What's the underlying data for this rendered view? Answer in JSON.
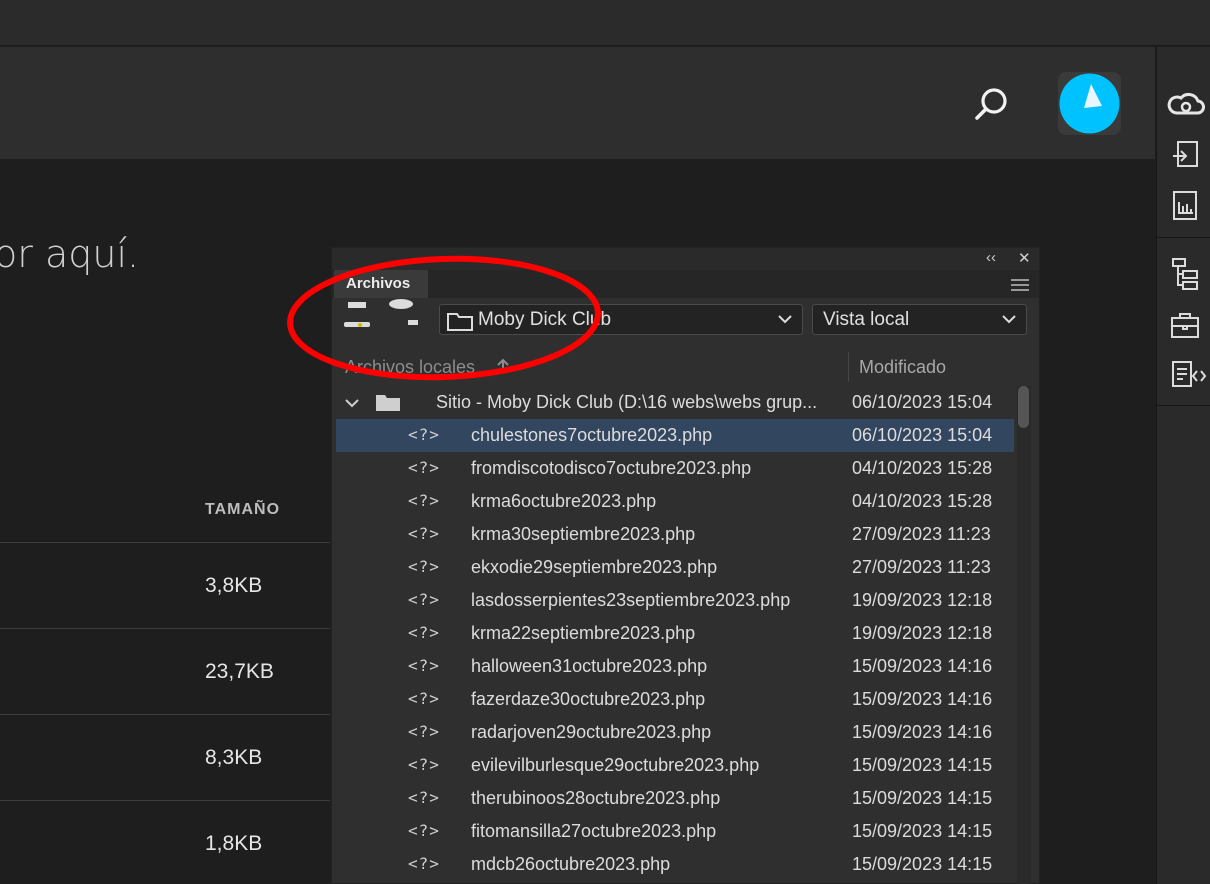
{
  "header": {
    "search_icon": "search-icon",
    "avatar_color": "#00c2ff"
  },
  "main": {
    "hero_text": "or aquí.",
    "size_column": "TAMAÑO",
    "sizes": [
      "3,8KB",
      "23,7KB",
      "8,3KB",
      "1,8KB"
    ]
  },
  "panel": {
    "tab_label": "Archivos",
    "collapse_glyph": "‹‹",
    "close_glyph": "✕",
    "site_select": "Moby Dick Club",
    "view_select": "Vista local",
    "col_local": "Archivos locales",
    "col_modified": "Modificado",
    "root": {
      "label": "Sitio - Moby Dick Club (D:\\16 webs\\webs grup...",
      "date": "06/10/2023 15:04"
    },
    "file_icon_glyph": "<?>",
    "files": [
      {
        "name": "chulestones7octubre2023.php",
        "date": "06/10/2023 15:04",
        "selected": true
      },
      {
        "name": "fromdiscotodisco7octubre2023.php",
        "date": "04/10/2023 15:28"
      },
      {
        "name": "krma6octubre2023.php",
        "date": "04/10/2023 15:28"
      },
      {
        "name": "krma30septiembre2023.php",
        "date": "27/09/2023 11:23"
      },
      {
        "name": "ekxodie29septiembre2023.php",
        "date": "27/09/2023 11:23"
      },
      {
        "name": "lasdosserpientes23septiembre2023.php",
        "date": "19/09/2023 12:18"
      },
      {
        "name": "krma22septiembre2023.php",
        "date": "19/09/2023 12:18"
      },
      {
        "name": "halloween31octubre2023.php",
        "date": "15/09/2023 14:16"
      },
      {
        "name": "fazerdaze30octubre2023.php",
        "date": "15/09/2023 14:16"
      },
      {
        "name": "radarjoven29octubre2023.php",
        "date": "15/09/2023 14:16"
      },
      {
        "name": "evilevilburlesque29octubre2023.php",
        "date": "15/09/2023 14:15"
      },
      {
        "name": "therubinoos28octubre2023.php",
        "date": "15/09/2023 14:15"
      },
      {
        "name": "fitomansilla27octubre2023.php",
        "date": "15/09/2023 14:15"
      },
      {
        "name": "mdcb26octubre2023.php",
        "date": "15/09/2023 14:15"
      }
    ]
  },
  "colors": {
    "selected_row": "#33465f",
    "annotation": "#ff0000",
    "accent_cyan": "#00c2ff"
  }
}
